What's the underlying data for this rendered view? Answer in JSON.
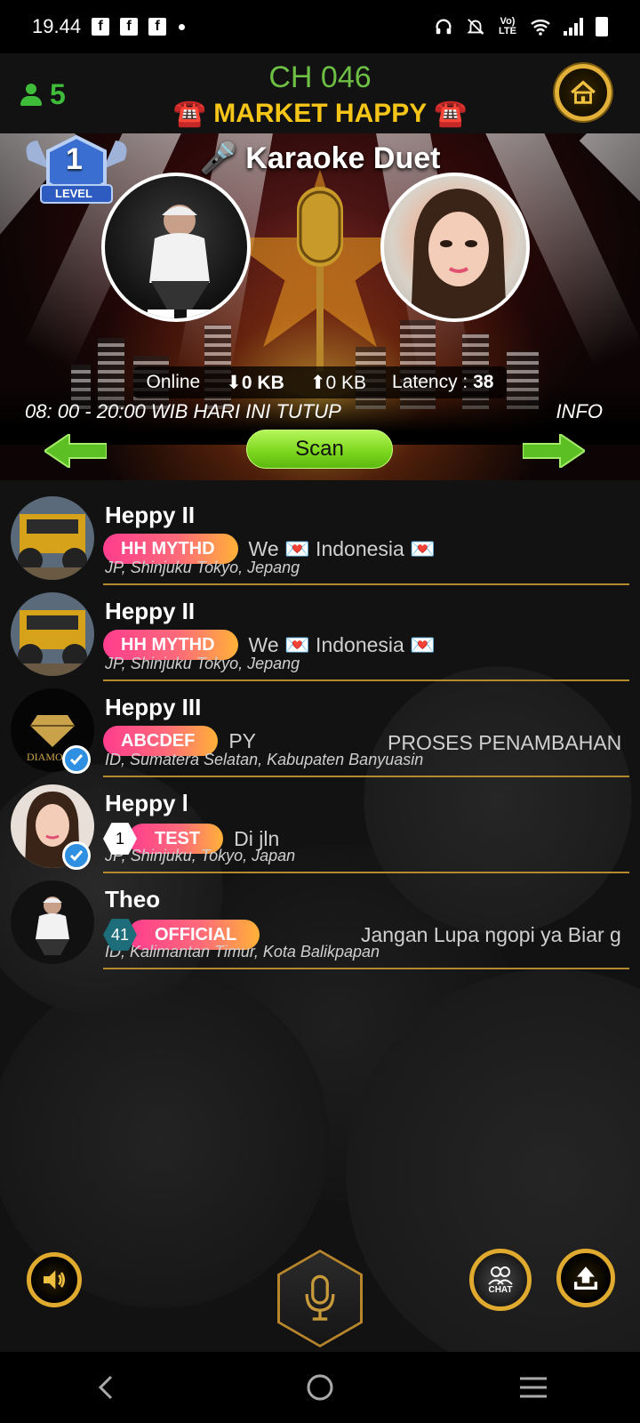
{
  "status_bar": {
    "time": "19.44",
    "fb_icon": "f",
    "network_label": "Vo) LTE"
  },
  "header": {
    "user_count": "5",
    "channel": "CH 046",
    "room_name": "☎️ MARKET HAPPY ☎️"
  },
  "banner": {
    "title": "🎤 Karaoke Duet",
    "level_number": "1",
    "level_label": "LEVEL",
    "online_label": "Online",
    "download": "0 KB",
    "upload": "0 KB",
    "latency_label": "Latency :",
    "latency_value": "38",
    "schedule": "08: 00 - 20:00 WIB HARI INI TUTUP",
    "info": "INFO",
    "scan_label": "Scan"
  },
  "users": [
    {
      "name": "Heppy II",
      "badge": "HH MYTHD",
      "status": "We 💌 Indonesia 💌",
      "location": "JP, Shinjuku Tokyo, Jepang"
    },
    {
      "name": "Heppy II",
      "badge": "HH MYTHD",
      "status": "We 💌 Indonesia 💌",
      "location": "JP, Shinjuku Tokyo, Jepang"
    },
    {
      "name": "Heppy III",
      "badge": "ABCDEF",
      "status": "PY",
      "status_right": "PROSES PENAMBAHAN",
      "location": "ID, Sumatera Selatan, Kabupaten Banyuasin",
      "avatar_text": "DIAMO"
    },
    {
      "name": "Heppy l",
      "level": "1",
      "badge": "TEST",
      "status": "Di jln",
      "location": "JP, Shinjuku, Tokyo, Japan"
    },
    {
      "name": "Theo",
      "level": "41",
      "badge": "OFFICIAL",
      "status_right": "Jangan Lupa ngopi ya Biar g",
      "location": "ID, Kalimantan Timur, Kota Balikpapan"
    }
  ],
  "controls": {
    "chat_label": "CHAT"
  },
  "colors": {
    "accent_green": "#6dc043",
    "gold": "#e0aa2e",
    "room_name": "#f5c518"
  }
}
